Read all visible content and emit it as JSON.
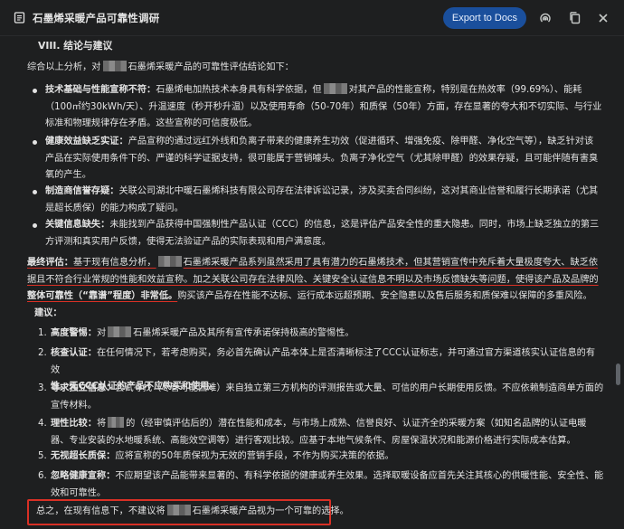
{
  "header": {
    "title": "石墨烯采暖产品可靠性调研",
    "export_label": "Export to Docs"
  },
  "section": {
    "heading": "VIII. 结论与建议",
    "intro_pre": "综合以上分析，对",
    "intro_post": "石墨烯采暖产品的可靠性评估结论如下："
  },
  "bullets": [
    {
      "label": "技术基础与性能宣称不符：",
      "l1": "石墨烯电加热技术本身具有科学依据，但",
      "l1b": "对其产品的性能宣称，特别是在热效率（99.69%）、能耗",
      "l2": "（100㎡约30kWh/天）、升温速度（秒开秒升温）以及使用寿命（50-70年）和质保（50年）方面，存在显著的夸大和不切实际、与行业",
      "l3": "标准和物理规律存在矛盾。这些宣称的可信度极低。"
    },
    {
      "label": "健康效益缺乏实证：",
      "l1": "产品宣称的通过远红外线和负离子带来的健康养生功效（促进循环、增强免疫、除甲醛、净化空气等），缺乏针对该",
      "l2": "产品在实际使用条件下的、严谨的科学证据支持，很可能属于营销噱头。负离子净化空气（尤其除甲醛）的效果存疑，且可能伴随有害臭",
      "l3": "氧的产生。"
    },
    {
      "label": "制造商信誉存疑：",
      "l1": "关联公司湖北中暖石墨烯科技有限公司存在法律诉讼记录，涉及买卖合同纠纷，这对其商业信誉和履行长期承诺（尤其",
      "l2": "是超长质保）的能力构成了疑问。"
    },
    {
      "label": "关键信息缺失：",
      "l1": "未能找到产品获得中国强制性产品认证（CCC）的信息，这是评估产品安全性的重大隐患。同时，市场上缺乏独立的第三",
      "l2": "方评测和真实用户反馈，使得无法验证产品的实际表现和用户满意度。"
    }
  ],
  "final": {
    "label": "最终评估：",
    "l1a": "基于现有信息分析，",
    "l1b": "石墨烯采暖产品系列虽然采用了具有潜力的石墨烯技术，但其营销宣传中充斥着大量极度夸大、缺乏依",
    "l2": "据且不符合行业常规的性能和效益宣称。加之关联公司存在法律风险、关键安全认证信息不明以及市场反馈缺失等问题，使得该产品及品牌的",
    "l3a": "整体可靠性（“靠谱”程度）非常低。",
    "l3b": "购买该产品存在性能不达标、运行成本远超预期、安全隐患以及售后服务和质保难以保障的多重风险。"
  },
  "advice": {
    "heading": "建议：",
    "items": [
      {
        "n": "1.",
        "label": "高度警惕：",
        "l1a": "对",
        "l1b": "石墨烯采暖产品及其所有宣传承诺保持极高的警惕性。"
      },
      {
        "n": "2.",
        "label": "核查认证：",
        "l1": "在任何情况下，若考虑购买，务必首先确认产品本体上是否清晰标注了CCC认证标志，并可通过官方渠道核实认证信息的有效",
        "l2": "性。无CCC认证的产品不应购买和使用。"
      },
      {
        "n": "3.",
        "label": "寻求独立信息：",
        "l1": "尝试寻找（尽管可能困难）来自独立第三方机构的评测报告或大量、可信的用户长期使用反馈。不应依赖制造商单方面的",
        "l2": "宣传材料。"
      },
      {
        "n": "4.",
        "label": "理性比较：",
        "l1a": "将",
        "l1b": "的（经审慎评估后的）潜在性能和成本，与市场上成熟、信誉良好、认证齐全的采暖方案（如知名品牌的认证电暖",
        "l2": "器、专业安装的水地暖系统、高能效空调等）进行客观比较。应基于本地气候条件、房屋保温状况和能源价格进行实际成本估算。"
      },
      {
        "n": "5.",
        "label": "无视超长质保：",
        "l1": "应将宣称的50年质保视为无效的营销手段，不作为购买决策的依据。"
      },
      {
        "n": "6.",
        "label": "忽略健康宣称：",
        "l1": "不应期望该产品能带来显著的、有科学依据的健康或养生效果。选择取暖设备应首先关注其核心的供暖性能、安全性、能",
        "l2": "效和可靠性。"
      }
    ]
  },
  "summary": {
    "pre": "总之，在现有信息下，不建议将",
    "post": "石墨烯采暖产品视为一个可靠的选择。"
  }
}
